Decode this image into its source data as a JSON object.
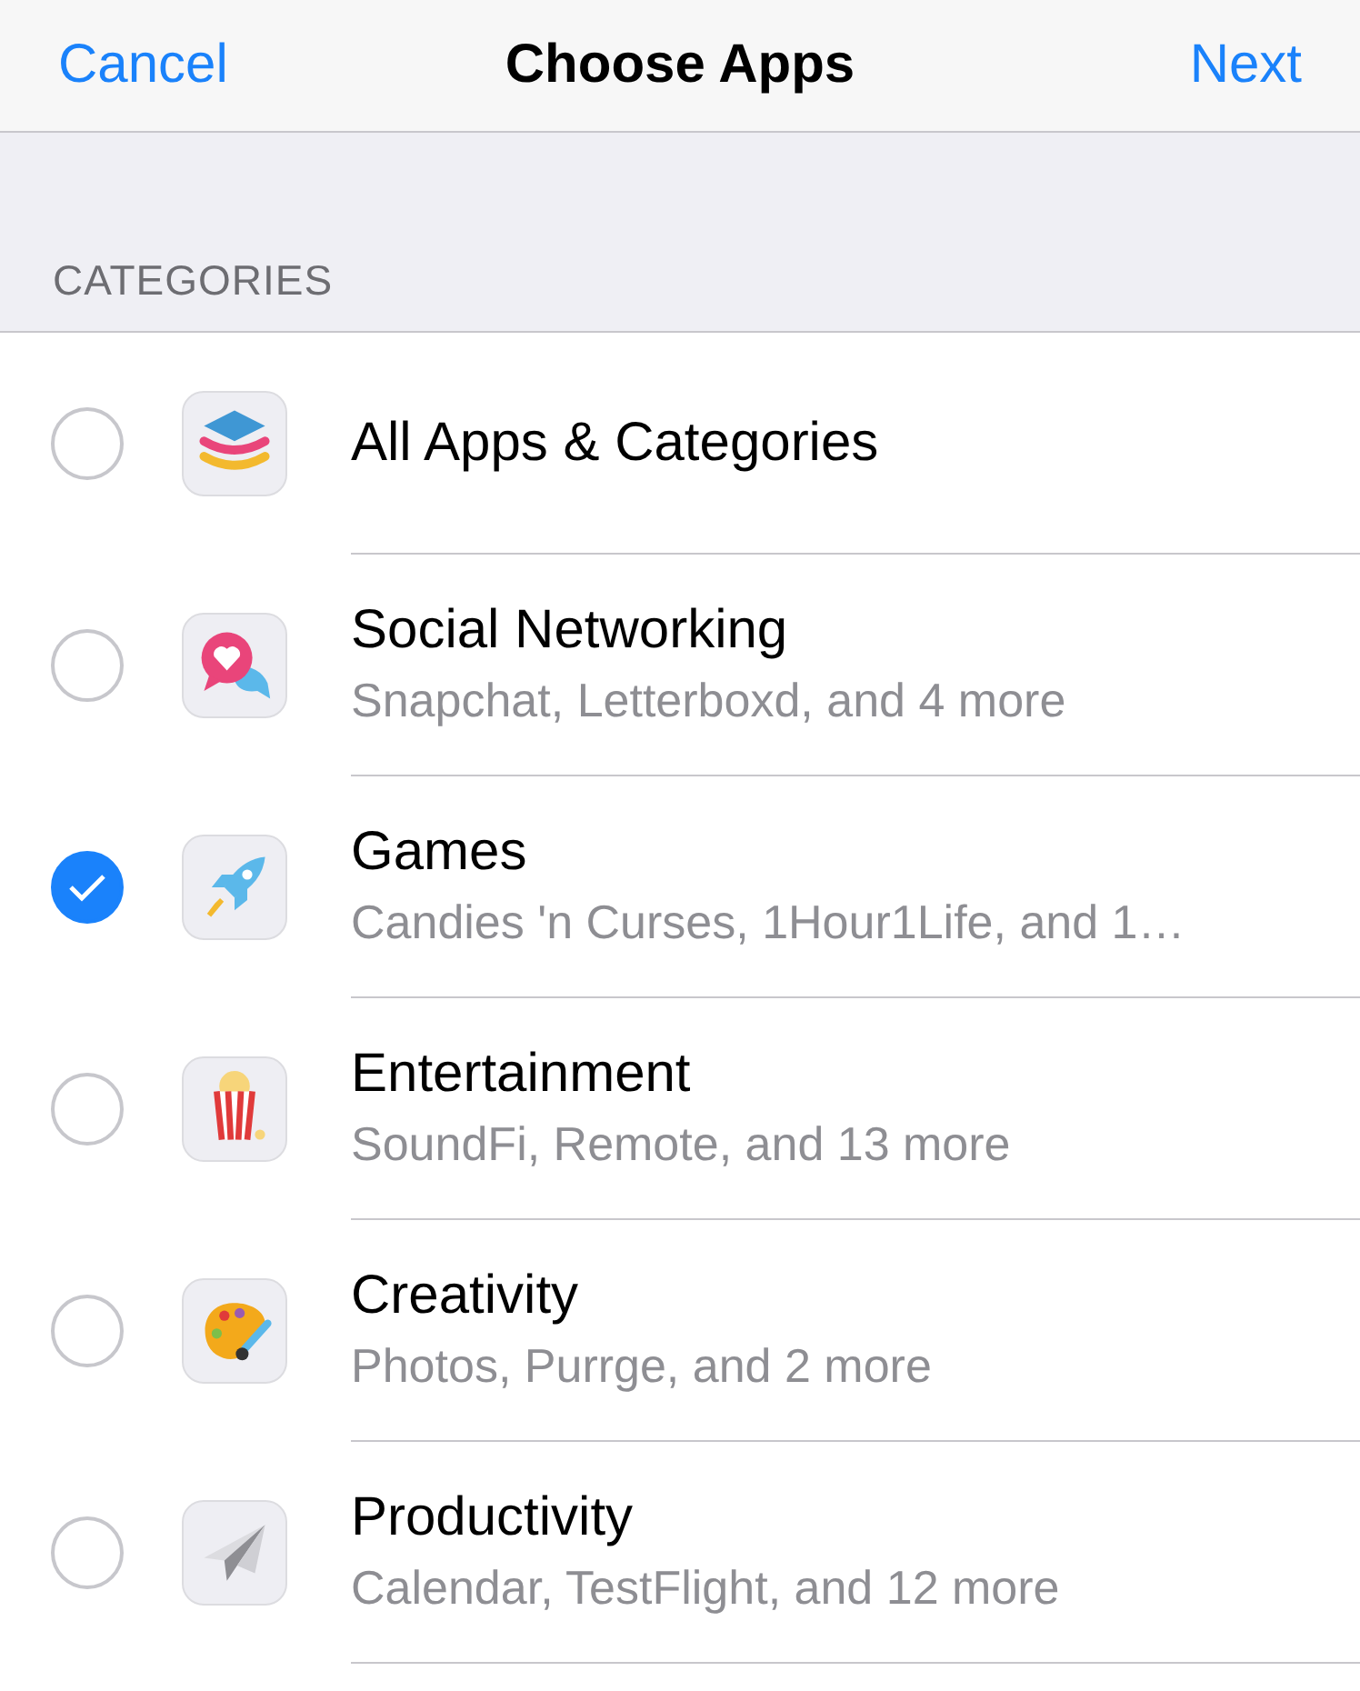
{
  "nav_bar": {
    "cancel": "Cancel",
    "title": "Choose Apps",
    "next": "Next"
  },
  "section_header": "CATEGORIES",
  "categories": [
    {
      "title": "All Apps & Categories",
      "selected": false
    },
    {
      "title": "Social Networking",
      "subtitle": "Snapchat, Letterboxd, and 4 more",
      "selected": false
    },
    {
      "title": "Games",
      "subtitle": "Candies 'n Curses, 1Hour1Life, and 1…",
      "selected": true
    },
    {
      "title": "Entertainment",
      "subtitle": "SoundFi, Remote, and 13 more",
      "selected": false
    },
    {
      "title": "Creativity",
      "subtitle": "Photos, Purrge, and 2 more",
      "selected": false
    },
    {
      "title": "Productivity",
      "subtitle": "Calendar, TestFlight, and 12 more",
      "selected": false
    }
  ]
}
